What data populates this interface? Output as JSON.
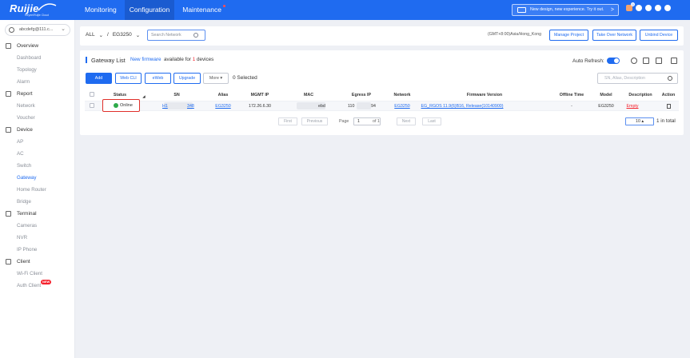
{
  "brand": {
    "name": "Ruijie",
    "tagline": "Reyee/Ruijie Cloud"
  },
  "nav": {
    "items": [
      {
        "label": "Monitoring"
      },
      {
        "label": "Configuration"
      },
      {
        "label": "Maintenance"
      }
    ],
    "active": "Configuration"
  },
  "banner": {
    "text": "New design, new experience. Try it out.",
    "arrow": ">"
  },
  "top_icons": [
    "gift-icon",
    "notification-icon",
    "settings-icon",
    "help-icon",
    "user-icon"
  ],
  "notification_count": "0",
  "account": {
    "label": "abcdefg@111.c..."
  },
  "sidebar": {
    "sections": [
      {
        "label": "Overview",
        "icon": "home-icon",
        "items": [
          "Dashboard",
          "Topology",
          "Alarm"
        ]
      },
      {
        "label": "Report",
        "icon": "report-icon",
        "items": [
          "Network",
          "Voucher"
        ]
      },
      {
        "label": "Device",
        "icon": "device-icon",
        "items": [
          "AP",
          "AC",
          "Switch",
          "Gateway",
          "Home Router",
          "Bridge"
        ]
      },
      {
        "label": "Terminal",
        "icon": "terminal-icon",
        "items": [
          "Cameras",
          "NVR",
          "IP Phone"
        ]
      },
      {
        "label": "Client",
        "icon": "client-icon",
        "items": [
          "Wi-Fi Client",
          "Auth Client"
        ]
      }
    ],
    "active_item": "Gateway",
    "new_badge": "NEW"
  },
  "breadcrumb": {
    "root": "ALL",
    "separator": "/",
    "current": "EG3250"
  },
  "search": {
    "placeholder": "Search Network"
  },
  "timezone": "(GMT+8:00)Asia/Hong_Kong",
  "header_buttons": {
    "manage": "Manage Project",
    "takeover": "Take Over Network",
    "unbind": "Unbind Device"
  },
  "gateway_list": {
    "title": "Gateway List",
    "firmware_link": "New firmware",
    "firmware_text_pre": " available for ",
    "firmware_count": "1",
    "firmware_text_post": " devices",
    "auto_refresh_label": "Auto Refresh:",
    "auto_refresh_on": true
  },
  "toolbar": {
    "add": "Add",
    "webcli": "Web CLI",
    "eweb": "eWeb",
    "upgrade": "Upgrade",
    "more": "More ▾",
    "selected": "0 Selected",
    "search_placeholder": "SN, Alias, Description"
  },
  "table": {
    "columns": [
      "Status",
      "SN",
      "Alias",
      "MGMT IP",
      "MAC",
      "Egress IP",
      "Network",
      "Firmware Version",
      "Offline Time",
      "Model",
      "Description",
      "Action"
    ],
    "rows": [
      {
        "status": "Online",
        "sn_start": "H1",
        "sn_end": "348",
        "alias": "EG3250",
        "mgmt_ip": "172.26.6.30",
        "mac_start": "",
        "mac_end": "ebd",
        "egress_start": "110",
        "egress_end": "94",
        "network": "EG3250",
        "firmware": "EG_RGOS 11.9(6)B16, Release(10140900)",
        "offline_time": "-",
        "model": "EG3250",
        "description": "Empty"
      }
    ]
  },
  "pagination": {
    "first": "First",
    "previous": "Previous",
    "page_label": "Page",
    "page": "1",
    "of": "of 1",
    "next": "Next",
    "last": "Last",
    "size": "10 ▴",
    "total": "1 in total"
  }
}
